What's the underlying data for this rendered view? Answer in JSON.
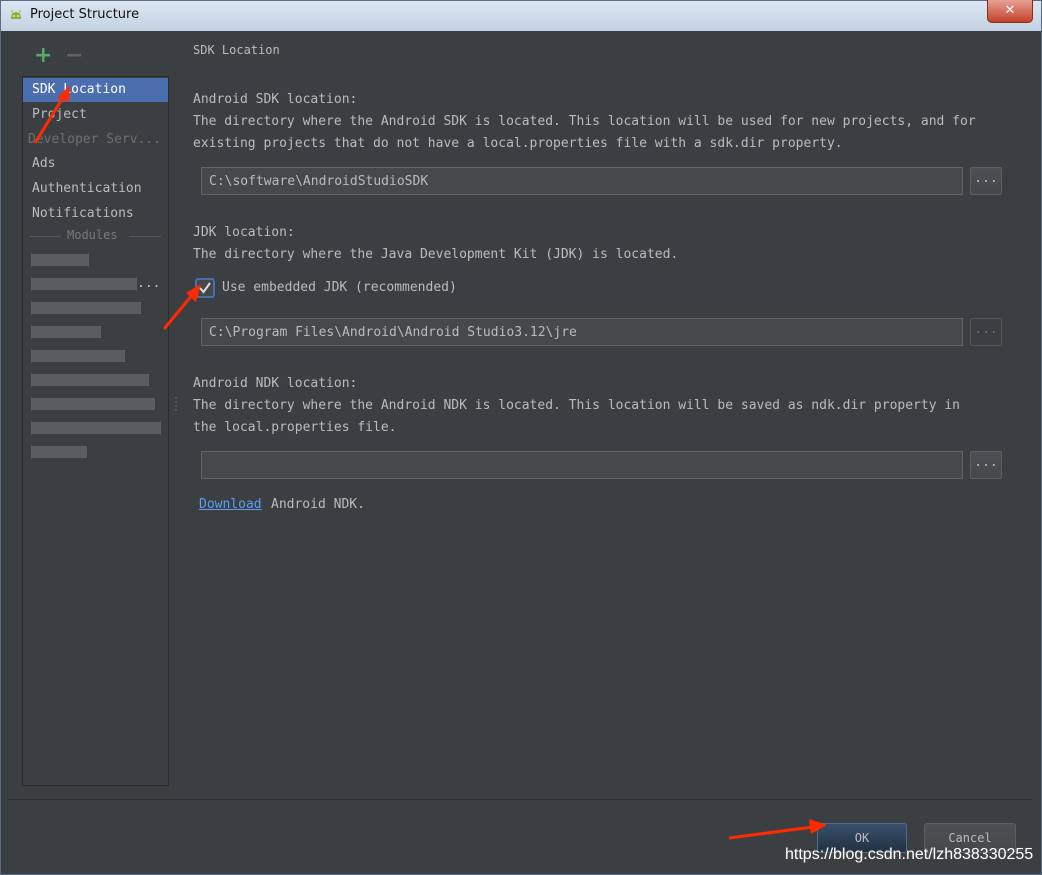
{
  "window": {
    "title": "Project Structure",
    "close_label": "✕"
  },
  "toolbar": {
    "add_label": "+",
    "remove_label": "−"
  },
  "sidebar": {
    "items": [
      {
        "label": "SDK Location"
      },
      {
        "label": "Project"
      },
      {
        "label": "Developer Serv..."
      },
      {
        "label": "Ads"
      },
      {
        "label": "Authentication"
      },
      {
        "label": "Notifications"
      }
    ],
    "modules_header": "Modules",
    "more": "..."
  },
  "main": {
    "section_title": "SDK Location",
    "sdk": {
      "label": "Android SDK location:",
      "desc_line1": "The directory where the Android SDK is located. This location will be used for new projects, and for",
      "desc_line2": "existing projects that do not have a local.properties file with a sdk.dir property.",
      "path": "C:\\software\\AndroidStudioSDK",
      "browse": "..."
    },
    "jdk": {
      "label": "JDK location:",
      "desc": "The directory where the Java Development Kit (JDK) is located.",
      "checkbox_label": "Use embedded JDK (recommended)",
      "checked": true,
      "path": "C:\\Program Files\\Android\\Android Studio3.12\\jre",
      "browse": "..."
    },
    "ndk": {
      "label": "Android NDK location:",
      "desc_line1": "The directory where the Android NDK is located. This location will be saved as ndk.dir property in",
      "desc_line2": "the local.properties file.",
      "path": "",
      "browse": "...",
      "download_link": "Download",
      "download_tail": "Android NDK."
    }
  },
  "footer": {
    "ok_label": "OK",
    "cancel_label": "Cancel"
  },
  "watermark": "https://blog.csdn.net/lzh838330255",
  "colors": {
    "background": "#3c3f41",
    "selection": "#4b6eaf",
    "link": "#589df6",
    "annotation_arrow": "#ff2a00"
  }
}
